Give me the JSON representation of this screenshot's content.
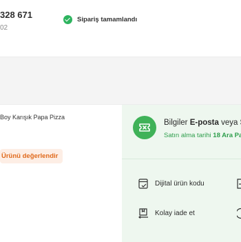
{
  "order": {
    "number": "328 671",
    "date": "02",
    "status_label": "Sipariş tamamlandı"
  },
  "product": {
    "name": "Boy Karışık Papa Pizza",
    "rate_label": "Ürünü değerlendir"
  },
  "info": {
    "line1_prefix": "Bilgiler ",
    "line1_bold": "E-posta",
    "line1_middle": " veya ",
    "line1_tail": "S",
    "line2_prefix": "Satın alma tarihi ",
    "line2_bold": "18 Ara Pa"
  },
  "actions": {
    "digital_code": "Dijital ürün kodu",
    "easy_return": "Kolay iade et"
  },
  "colors": {
    "brand_green": "#3fb258",
    "panel_green": "#eef7ef",
    "accent_orange": "#e06a1c"
  }
}
